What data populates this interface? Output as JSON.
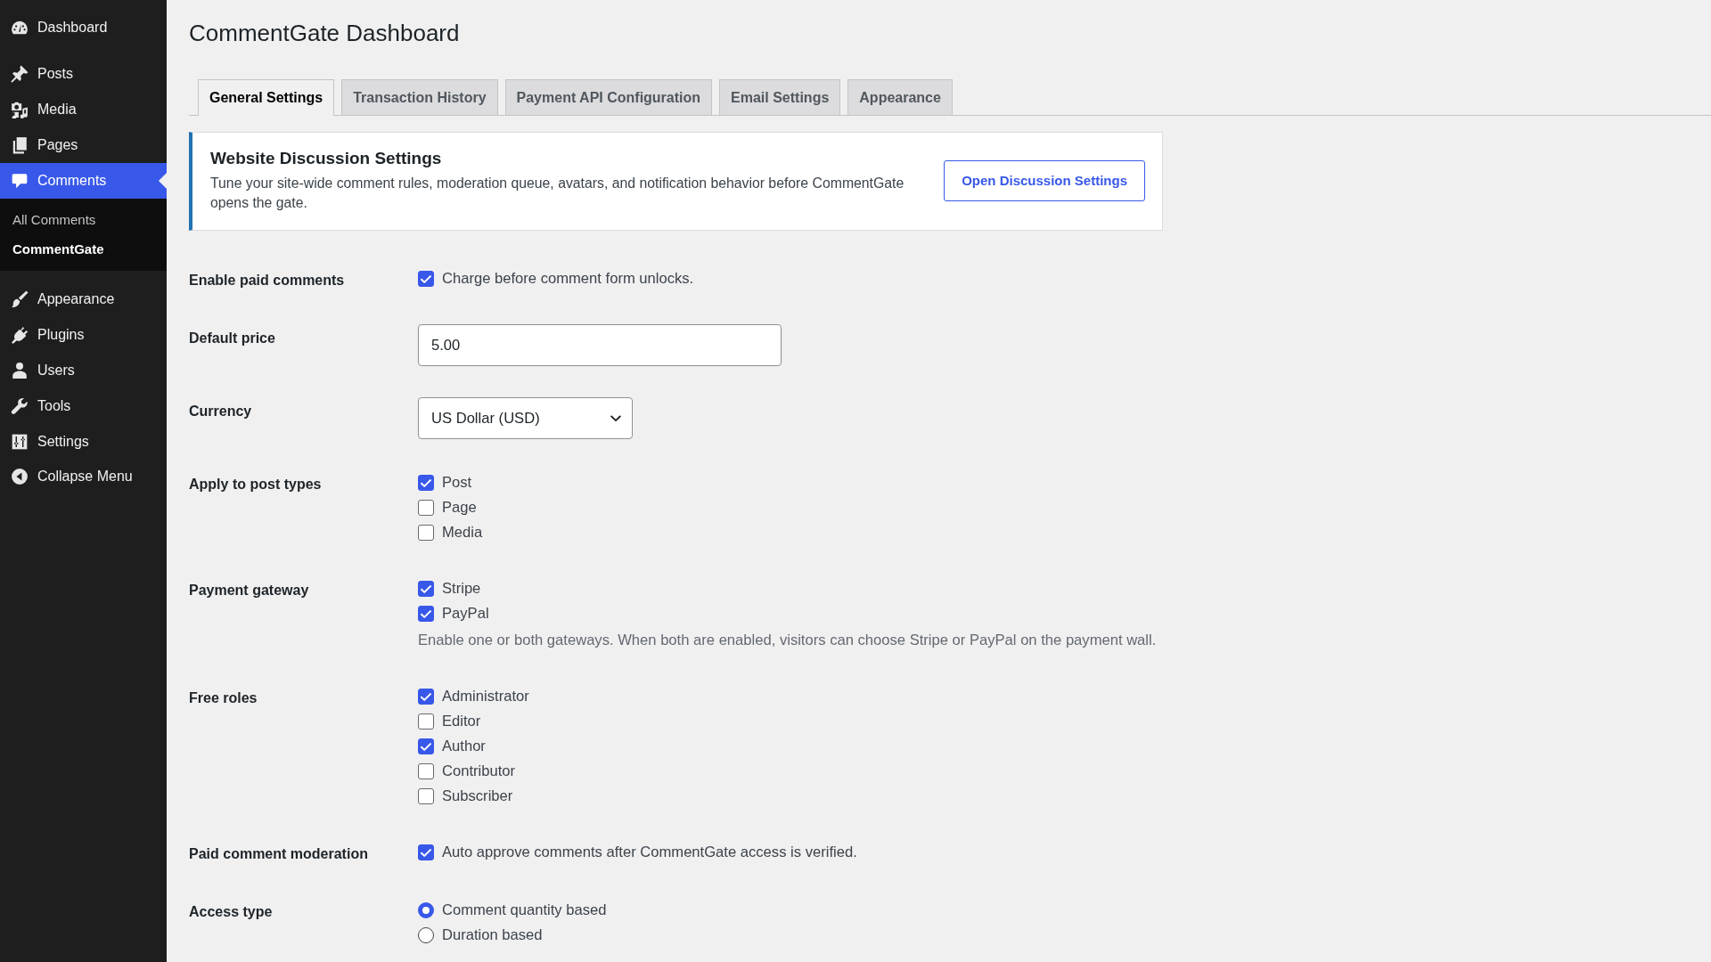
{
  "sidebar": {
    "menu_groups": [
      {
        "items": [
          {
            "label": "Dashboard",
            "selected": false
          }
        ]
      },
      {
        "items": [
          {
            "label": "Posts",
            "selected": false
          },
          {
            "label": "Media",
            "selected": false
          },
          {
            "label": "Pages",
            "selected": false
          },
          {
            "label": "Comments",
            "selected": true,
            "submenu": [
              {
                "label": "All Comments",
                "selected": false
              },
              {
                "label": "CommentGate",
                "selected": true
              }
            ]
          }
        ]
      },
      {
        "items": [
          {
            "label": "Appearance",
            "selected": false
          },
          {
            "label": "Plugins",
            "selected": false
          },
          {
            "label": "Users",
            "selected": false
          },
          {
            "label": "Tools",
            "selected": false
          },
          {
            "label": "Settings",
            "selected": false
          }
        ]
      }
    ],
    "collapse_button": {
      "label": "Collapse Menu"
    }
  },
  "page": {
    "title": "CommentGate Dashboard"
  },
  "tabs": [
    {
      "label": "General Settings",
      "selected": true
    },
    {
      "label": "Transaction History",
      "selected": false
    },
    {
      "label": "Payment API Configuration",
      "selected": false
    },
    {
      "label": "Email Settings",
      "selected": false
    },
    {
      "label": "Appearance",
      "selected": false
    }
  ],
  "notice": {
    "title": "Website Discussion Settings",
    "text": "Tune your site-wide comment rules, moderation queue, avatars, and notification behavior before CommentGate opens the gate.",
    "button": "Open Discussion Settings"
  },
  "form": {
    "rows": [
      {
        "kind": "checkboxes",
        "label": "Enable paid comments",
        "options": [
          {
            "label": "Charge before comment form unlocks.",
            "checked": true
          }
        ]
      },
      {
        "kind": "text",
        "label": "Default price",
        "value": "5.00"
      },
      {
        "kind": "select",
        "label": "Currency",
        "value": "US Dollar (USD)"
      },
      {
        "kind": "checkboxes",
        "label": "Apply to post types",
        "options": [
          {
            "label": "Post",
            "checked": true
          },
          {
            "label": "Page",
            "checked": false
          },
          {
            "label": "Media",
            "checked": false
          }
        ]
      },
      {
        "kind": "checkboxes",
        "label": "Payment gateway",
        "options": [
          {
            "label": "Stripe",
            "checked": true
          },
          {
            "label": "PayPal",
            "checked": true
          }
        ],
        "hint": "Enable one or both gateways. When both are enabled, visitors can choose Stripe or PayPal on the payment wall."
      },
      {
        "kind": "checkboxes",
        "label": "Free roles",
        "options": [
          {
            "label": "Administrator",
            "checked": true
          },
          {
            "label": "Editor",
            "checked": false
          },
          {
            "label": "Author",
            "checked": true
          },
          {
            "label": "Contributor",
            "checked": false
          },
          {
            "label": "Subscriber",
            "checked": false
          }
        ]
      },
      {
        "kind": "checkboxes",
        "label": "Paid comment moderation",
        "options": [
          {
            "label": "Auto approve comments after CommentGate access is verified.",
            "checked": true
          }
        ]
      },
      {
        "kind": "radios",
        "label": "Access type",
        "options": [
          {
            "label": "Comment quantity based",
            "selected": true
          },
          {
            "label": "Duration based",
            "selected": false
          }
        ]
      }
    ]
  }
}
